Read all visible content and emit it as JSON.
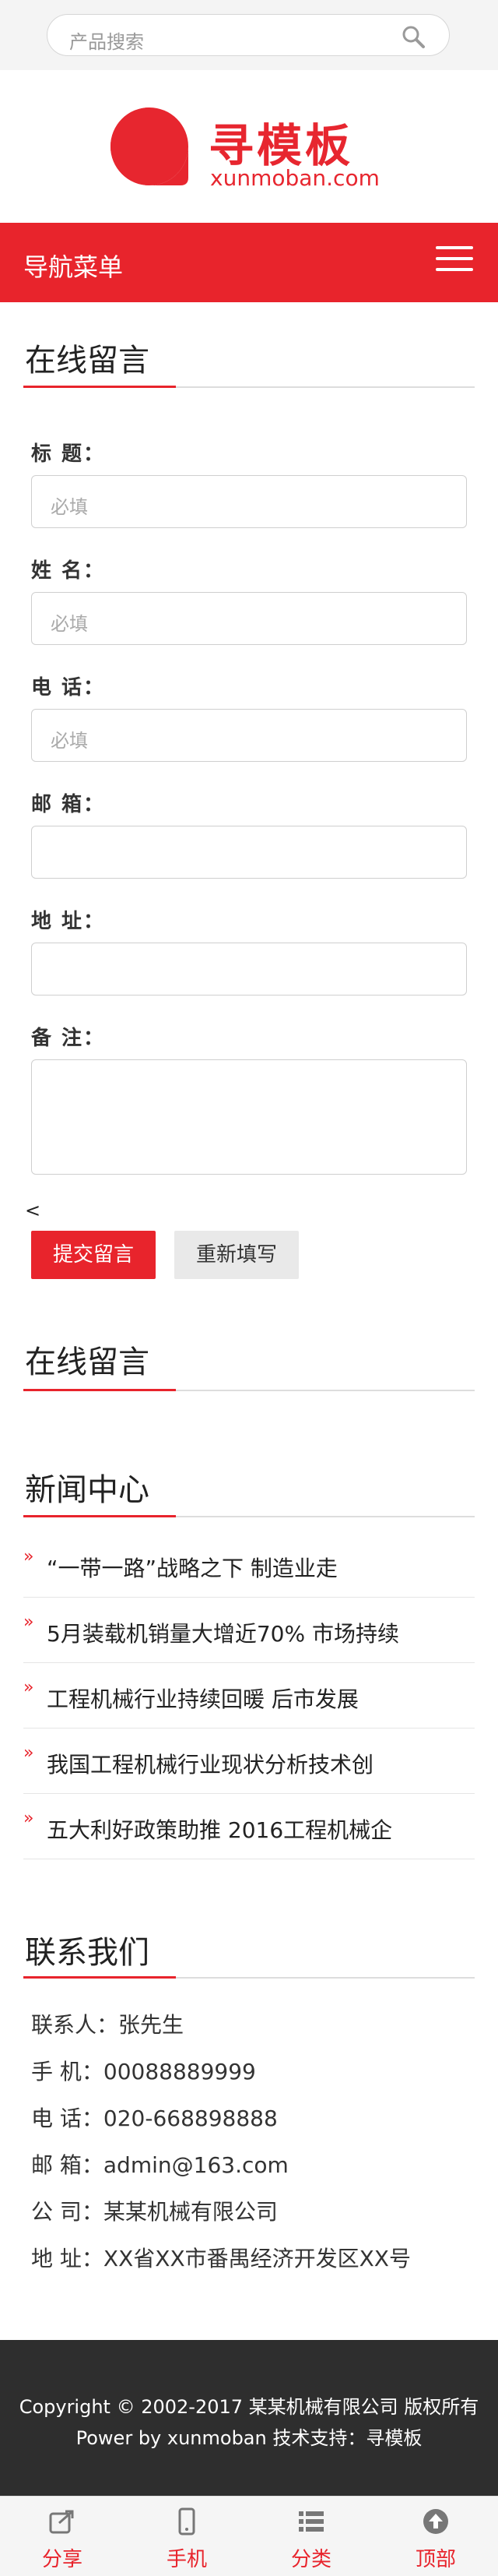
{
  "search": {
    "placeholder": "产品搜索"
  },
  "logo": {
    "title": "寻模板",
    "sub": "xunmoban.com"
  },
  "nav": {
    "label": "导航菜单"
  },
  "form_section": {
    "title": "在线留言",
    "fields": [
      {
        "label": "标 题：",
        "placeholder": "必填"
      },
      {
        "label": "姓 名：",
        "placeholder": "必填"
      },
      {
        "label": "电 话：",
        "placeholder": "必填"
      },
      {
        "label": "邮 箱：",
        "placeholder": ""
      },
      {
        "label": "地 址：",
        "placeholder": ""
      },
      {
        "label": "备 注：",
        "placeholder": ""
      }
    ],
    "stray": "<",
    "submit": "提交留言",
    "reset": "重新填写"
  },
  "section2": {
    "title": "在线留言"
  },
  "news": {
    "title": "新闻中心",
    "bullet": "»",
    "items": [
      "“一带一路”战略之下 制造业走",
      "5月装载机销量大增近70% 市场持续",
      "工程机械行业持续回暖 后市发展",
      "我国工程机械行业现状分析技术创",
      "五大利好政策助推 2016工程机械企"
    ]
  },
  "contact": {
    "title": "联系我们",
    "lines": [
      "联系人：张先生",
      "手 机：00088889999",
      "电 话：020-668898888",
      "邮 箱：admin@163.com",
      "公 司：某某机械有限公司",
      "地 址：XX省XX市番禺经济开发区XX号"
    ]
  },
  "footer": {
    "line1": "Copyright © 2002-2017 某某机械有限公司 版权所有",
    "line2": "Power by xunmoban 技术支持：寻模板"
  },
  "tabbar": [
    {
      "label": "分享",
      "icon": "share-icon"
    },
    {
      "label": "手机",
      "icon": "phone-icon"
    },
    {
      "label": "分类",
      "icon": "list-icon"
    },
    {
      "label": "顶部",
      "icon": "arrow-up-icon"
    }
  ],
  "colors": {
    "accent": "#e8242c",
    "footer": "#2e2e2e"
  }
}
